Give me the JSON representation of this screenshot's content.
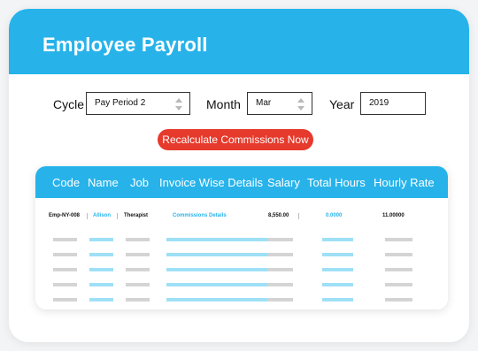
{
  "header": {
    "title": "Employee Payroll"
  },
  "filters": {
    "cycle_label": "Cycle",
    "cycle_value": "Pay Period 2",
    "month_label": "Month",
    "month_value": "Mar",
    "year_label": "Year",
    "year_value": "2019"
  },
  "actions": {
    "recalculate_label": "Recalculate Commissions Now"
  },
  "table": {
    "columns": [
      "Code",
      "Name",
      "Job",
      "Invoice Wise Details",
      "Salary",
      "Total Hours",
      "Hourly Rate"
    ],
    "first_row": {
      "code": "Emp-NY-008",
      "name": "Allison",
      "job": "Therapist",
      "details": "Commissions Details",
      "salary": "8,550.00",
      "hours": "0.0000",
      "rate": "11.00000"
    },
    "placeholder_rows": 5
  },
  "colors": {
    "accent": "#27b3ea",
    "action": "#e53a2c"
  }
}
